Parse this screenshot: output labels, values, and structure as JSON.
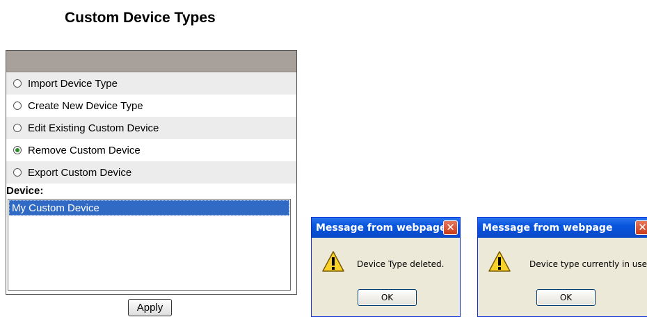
{
  "page": {
    "title": "Custom Device Types"
  },
  "options": [
    {
      "label": "Import Device Type",
      "checked": false
    },
    {
      "label": "Create New Device Type",
      "checked": false
    },
    {
      "label": "Edit Existing Custom Device",
      "checked": false
    },
    {
      "label": "Remove Custom Device",
      "checked": true
    },
    {
      "label": "Export Custom Device",
      "checked": false
    }
  ],
  "device": {
    "label": "Device:",
    "list": [
      {
        "label": "My Custom Device",
        "selected": true
      }
    ]
  },
  "apply_label": "Apply",
  "dialogs": [
    {
      "title": "Message from webpage",
      "close": "✕",
      "message": "Device Type deleted.",
      "ok": "OK",
      "icon": "warning-icon"
    },
    {
      "title": "Message from webpage",
      "close": "✕",
      "message": "Device type currently in use.",
      "ok": "OK",
      "icon": "warning-icon"
    }
  ],
  "colors": {
    "header_bar": "#a8a19b",
    "selection": "#316ac5",
    "dialog_title": "#0855dd",
    "dialog_bg": "#ece9d8"
  }
}
